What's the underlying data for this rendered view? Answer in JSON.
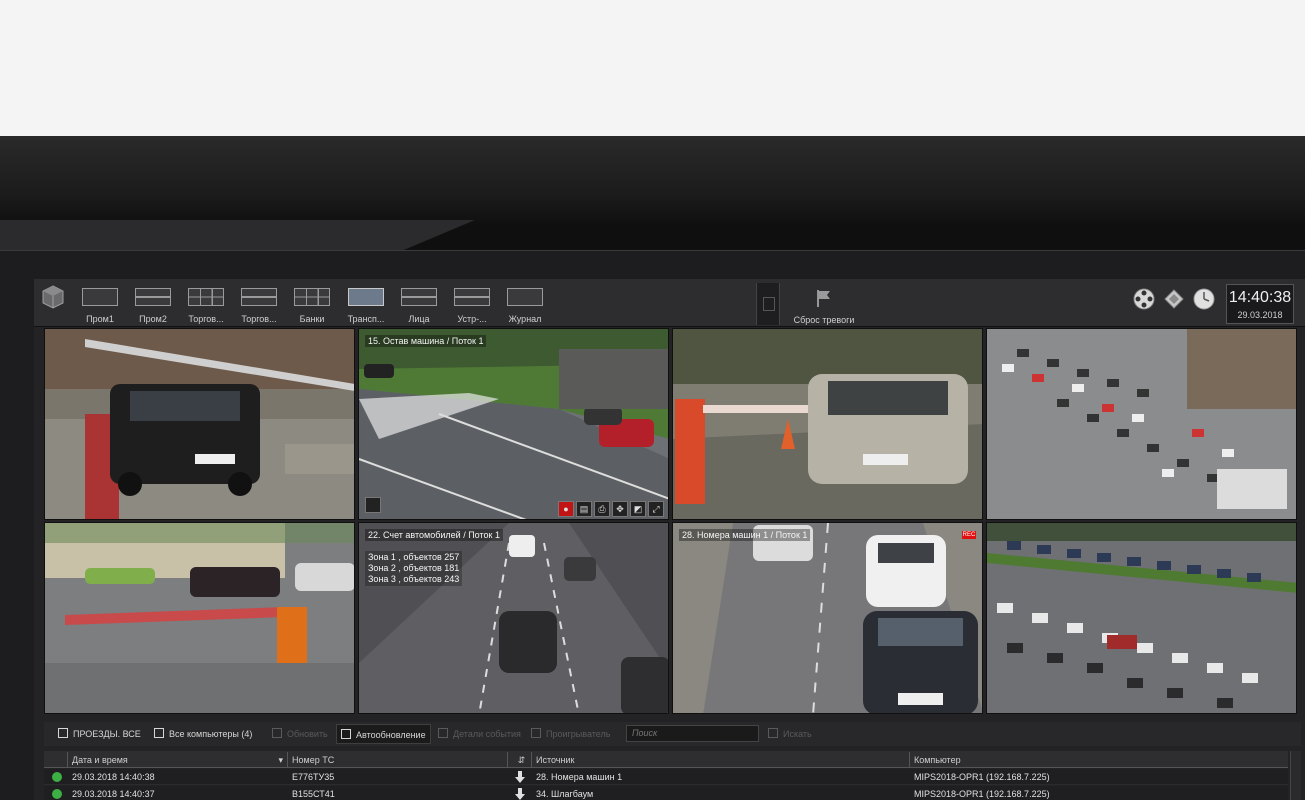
{
  "toolbar": {
    "layouts": [
      {
        "label": "Пром1"
      },
      {
        "label": "Пром2"
      },
      {
        "label": "Торгов..."
      },
      {
        "label": "Торгов..."
      },
      {
        "label": "Банки"
      },
      {
        "label": "Трансп..."
      },
      {
        "label": "Лица"
      },
      {
        "label": "Устр-..."
      },
      {
        "label": "Журнал"
      }
    ],
    "alarm_reset_label": "Сброс тревоги",
    "clock_time": "14:40:38",
    "clock_date": "29.03.2018"
  },
  "cameras": [
    {
      "title": ""
    },
    {
      "title": "15. Остав машина / Поток 1"
    },
    {
      "title": ""
    },
    {
      "title": ""
    },
    {
      "title": ""
    },
    {
      "title": "22. Счет автомобилей / Поток 1",
      "zones": [
        "Зона 1 , объектов 257",
        "Зона 2 , объектов 181",
        "Зона 3 , объектов 243"
      ]
    },
    {
      "title": "28. Номера машин 1 / Поток 1"
    },
    {
      "title": ""
    }
  ],
  "journal": {
    "toolbar": {
      "passes_label": "ПРОЕЗДЫ. ВСЕ",
      "computers_label": "Все компьютеры (4)",
      "refresh_label": "Обновить",
      "autorefresh_label": "Автообновление",
      "event_details_label": "Детали события",
      "play_label": "Проигрыватель",
      "search_placeholder": "Поиск",
      "find_label": "Искать"
    },
    "columns": {
      "datetime": "Дата и время",
      "plate": "Номер ТС",
      "source": "Источник",
      "computer": "Компьютер"
    },
    "rows": [
      {
        "datetime": "29.03.2018 14:40:38",
        "plate": "Е776ТУ35",
        "source": "28. Номера машин 1",
        "computer": "MIPS2018-OPR1 (192.168.7.225)"
      },
      {
        "datetime": "29.03.2018 14:40:37",
        "plate": "В155СТ41",
        "source": "34. Шлагбаум",
        "computer": "MIPS2018-OPR1 (192.168.7.225)"
      }
    ]
  },
  "colors": {
    "accent": "#3cb043",
    "rec": "#e01010"
  }
}
